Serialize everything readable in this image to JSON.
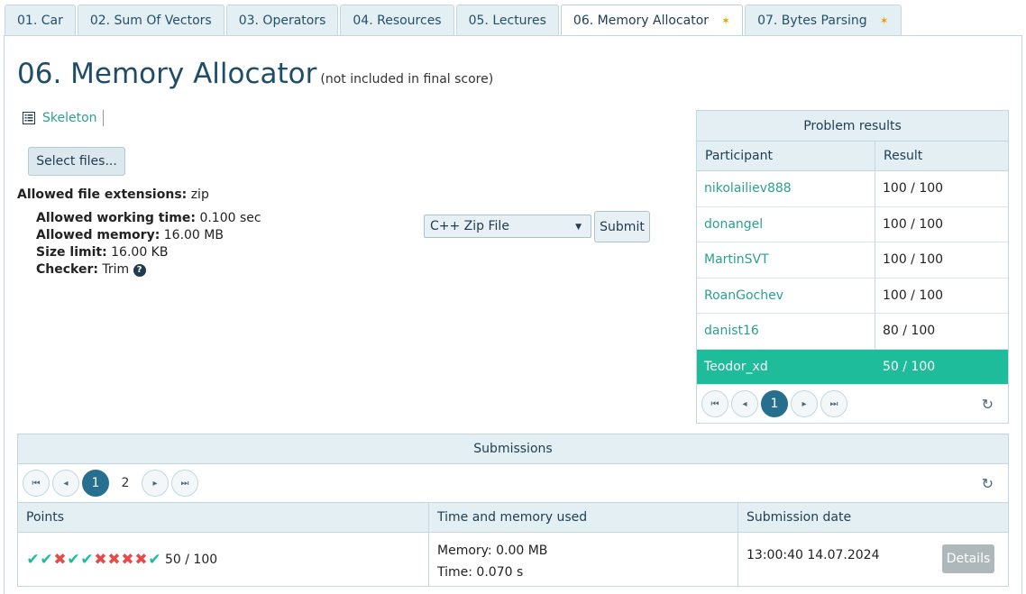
{
  "tabs": [
    {
      "label": "01. Car",
      "active": false,
      "star": false
    },
    {
      "label": "02. Sum Of Vectors",
      "active": false,
      "star": false
    },
    {
      "label": "03. Operators",
      "active": false,
      "star": false
    },
    {
      "label": "04. Resources",
      "active": false,
      "star": false
    },
    {
      "label": "05. Lectures",
      "active": false,
      "star": false
    },
    {
      "label": "06. Memory Allocator",
      "active": true,
      "star": true
    },
    {
      "label": "07. Bytes Parsing",
      "active": false,
      "star": true
    }
  ],
  "problem": {
    "title": "06. Memory Allocator",
    "note": "(not included in final score)",
    "skeleton_label": "Skeleton",
    "select_files_label": "Select files...",
    "extensions_label": "Allowed file extensions:",
    "extensions_value": "zip",
    "time_label": "Allowed working time:",
    "time_value": "0.100 sec",
    "memory_label": "Allowed memory:",
    "memory_value": "16.00 MB",
    "size_label": "Size limit:",
    "size_value": "16.00 KB",
    "checker_label": "Checker:",
    "checker_value": "Trim",
    "language": "C++ Zip File",
    "submit_label": "Submit"
  },
  "results": {
    "caption": "Problem results",
    "col_participant": "Participant",
    "col_result": "Result",
    "rows": [
      {
        "participant": "nikolailiev888",
        "result": "100 / 100"
      },
      {
        "participant": "donangel",
        "result": "100 / 100"
      },
      {
        "participant": "MartinSVT",
        "result": "100 / 100"
      },
      {
        "participant": "RoanGochev",
        "result": "100 / 100"
      },
      {
        "participant": "danist16",
        "result": "80 / 100"
      },
      {
        "participant": "Teodor_xd",
        "result": "50 / 100"
      }
    ],
    "current_page": "1"
  },
  "submissions": {
    "caption": "Submissions",
    "pages": [
      "1",
      "2"
    ],
    "current_page": "1",
    "col_points": "Points",
    "col_time_memory": "Time and memory used",
    "col_date": "Submission date",
    "rows": [
      {
        "tests": [
          "ok",
          "ok",
          "bad",
          "ok",
          "ok",
          "bad",
          "bad",
          "bad",
          "bad",
          "ok"
        ],
        "points": "50 / 100",
        "memory": "Memory: 0.00 MB",
        "time": "Time: 0.070 s",
        "date": "13:00:40 14.07.2024",
        "details_label": "Details"
      }
    ]
  },
  "colors": {
    "accent": "#1fbc9c",
    "link": "#2aa190",
    "fail": "#e54b4b",
    "header_bg": "#e4eff4",
    "title": "#1f4d68"
  }
}
